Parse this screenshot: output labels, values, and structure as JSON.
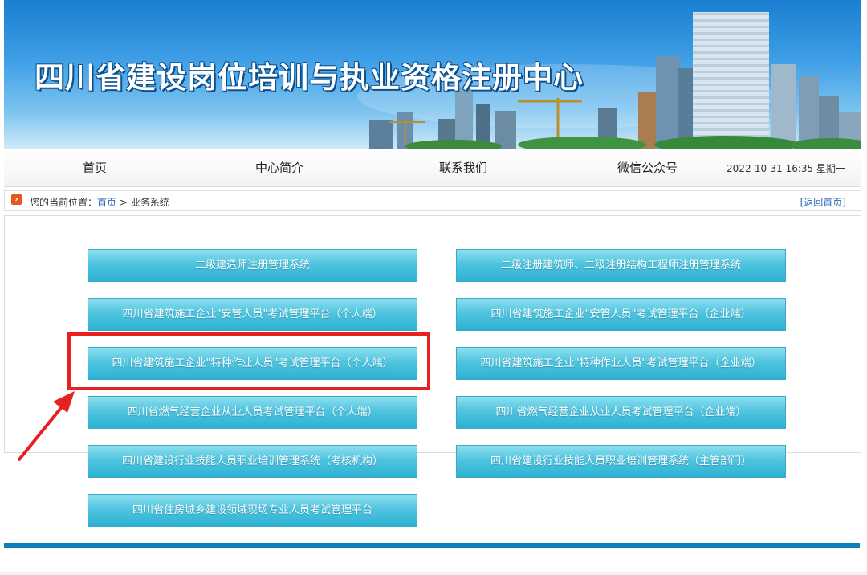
{
  "banner": {
    "title": "四川省建设岗位培训与执业资格注册中心"
  },
  "nav": {
    "items": [
      "首页",
      "中心简介",
      "联系我们",
      "微信公众号"
    ],
    "datetime": "2022-10-31 16:35 星期一"
  },
  "breadcrumb": {
    "icon": "chevron-right-icon",
    "prefix": "您的当前位置：",
    "home_link": "首页",
    "separator": " > ",
    "current": "业务系统",
    "back_link": "[返回首页]"
  },
  "systems": [
    "二级建造师注册管理系统",
    "二级注册建筑师、二级注册结构工程师注册管理系统",
    "四川省建筑施工企业\"安管人员\"考试管理平台（个人端）",
    "四川省建筑施工企业\"安管人员\"考试管理平台（企业端）",
    "四川省建筑施工企业\"特种作业人员\"考试管理平台（个人端）",
    "四川省建筑施工企业\"特种作业人员\"考试管理平台（企业端）",
    "四川省燃气经营企业从业人员考试管理平台（个人端）",
    "四川省燃气经营企业从业人员考试管理平台（企业端）",
    "四川省建设行业技能人员职业培训管理系统（考核机构）",
    "四川省建设行业技能人员职业培训管理系统（主管部门）",
    "四川省住房城乡建设领域现场专业人员考试管理平台"
  ],
  "colors": {
    "highlight": "#e8201f",
    "button": "#4fc4df",
    "footer_bar": "#0f7fb7"
  }
}
